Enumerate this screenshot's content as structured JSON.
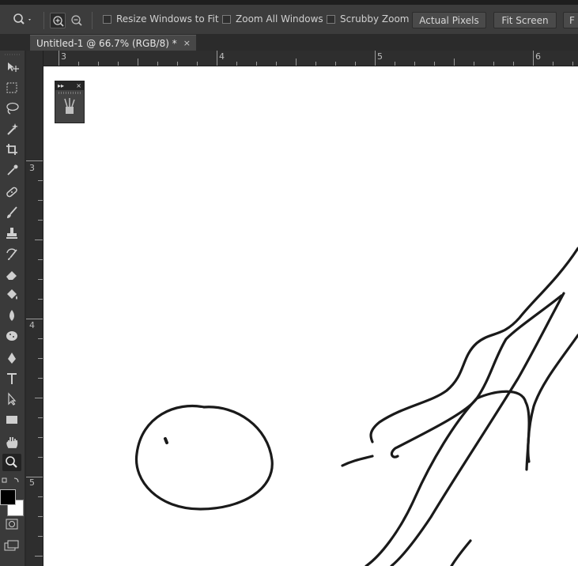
{
  "options_bar": {
    "checkboxes": [
      {
        "label": "Resize Windows to Fit",
        "checked": false
      },
      {
        "label": "Zoom All Windows",
        "checked": false
      },
      {
        "label": "Scrubby Zoom",
        "checked": false
      }
    ],
    "buttons": [
      "Actual Pixels",
      "Fit Screen",
      "F"
    ]
  },
  "document": {
    "tab_title": "Untitled-1 @ 66.7% (RGB/8) *",
    "close_glyph": "×"
  },
  "rulers": {
    "top": [
      "3",
      "4",
      "5",
      "6"
    ],
    "left": [
      "3",
      "4",
      "5"
    ]
  },
  "panel": {
    "expand_glyph": "▸▸",
    "close_glyph": "×",
    "icon": "brush-presets-icon"
  },
  "toolbar": {
    "tools": [
      "move-icon",
      "marquee-icon",
      "lasso-icon",
      "magic-wand-icon",
      "crop-icon",
      "eyedropper-icon",
      "spot-healing-icon",
      "brush-icon",
      "clone-stamp-icon",
      "history-brush-icon",
      "eraser-icon",
      "paint-bucket-icon",
      "blur-icon",
      "sponge-icon",
      "pen-icon",
      "type-icon",
      "path-selection-icon",
      "rectangle-icon",
      "hand-icon",
      "zoom-icon"
    ],
    "selected_tool": "zoom-icon",
    "foreground_color": "#000000",
    "background_color": "#ffffff"
  }
}
